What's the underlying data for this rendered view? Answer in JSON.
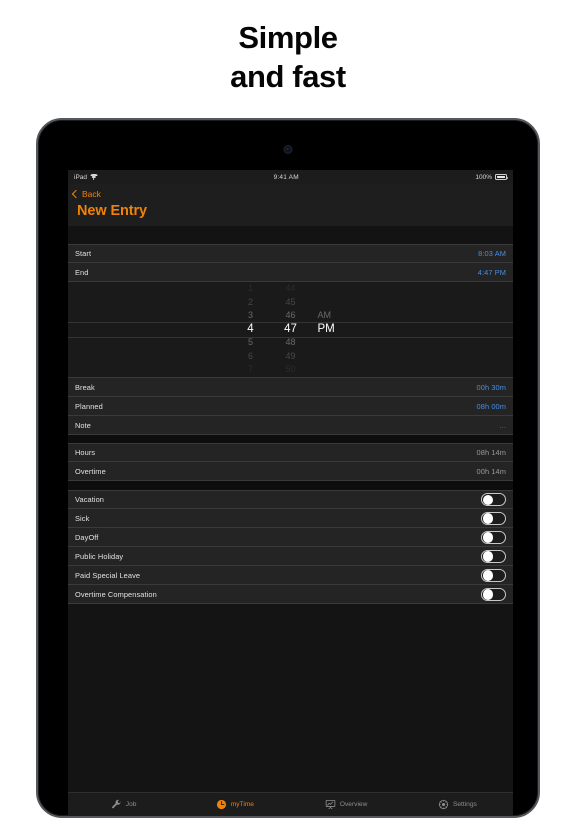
{
  "headline": {
    "line1": "Simple",
    "line2": "and fast"
  },
  "device": {
    "type": "tablet-frame",
    "camera": "front-camera-dot"
  },
  "status_bar": {
    "carrier": "iPad",
    "wifi_icon": "wifi-icon",
    "time": "9:41 AM",
    "battery_percent": "100%",
    "battery_icon": "battery-full-icon"
  },
  "nav": {
    "back_label": "Back",
    "back_icon": "chevron-left-icon",
    "title": "New Entry",
    "accent_color": "#f0820b"
  },
  "sections": {
    "time_rows": [
      {
        "label": "Start",
        "value": "8:03 AM",
        "value_style": "blue"
      },
      {
        "label": "End",
        "value": "4:47 PM",
        "value_style": "blue"
      }
    ],
    "detail_rows": [
      {
        "label": "Break",
        "value": "00h 30m",
        "value_style": "blue"
      },
      {
        "label": "Planned",
        "value": "08h 00m",
        "value_style": "blue"
      },
      {
        "label": "Note",
        "value": "...",
        "value_style": "dim"
      }
    ],
    "summary_rows": [
      {
        "label": "Hours",
        "value": "08h 14m",
        "value_style": "gray"
      },
      {
        "label": "Overtime",
        "value": "00h 14m",
        "value_style": "gray"
      }
    ],
    "toggle_rows": [
      {
        "label": "Vacation",
        "on": false
      },
      {
        "label": "Sick",
        "on": false
      },
      {
        "label": "DayOff",
        "on": false
      },
      {
        "label": "Public Holiday",
        "on": false
      },
      {
        "label": "Paid Special Leave",
        "on": false
      },
      {
        "label": "Overtime Compensation",
        "on": false
      }
    ]
  },
  "picker": {
    "hours": [
      "1",
      "2",
      "3",
      "4",
      "5",
      "6",
      "7"
    ],
    "minutes": [
      "44",
      "45",
      "46",
      "47",
      "48",
      "49",
      "50"
    ],
    "meridiem": [
      "",
      "",
      "AM",
      "PM",
      "",
      "",
      ""
    ],
    "selected": {
      "hour": "4",
      "minute": "47",
      "meridiem": "PM"
    }
  },
  "tabbar": {
    "tabs": [
      {
        "label": "Job",
        "icon": "wrench-icon",
        "active": false
      },
      {
        "label": "myTime",
        "icon": "clock-icon",
        "active": true
      },
      {
        "label": "Overview",
        "icon": "chart-board-icon",
        "active": false
      },
      {
        "label": "Settings",
        "icon": "gear-icon",
        "active": false
      }
    ]
  },
  "colors": {
    "accent": "#f0820b",
    "value_blue": "#4b8ee0",
    "row_bg": "#242424",
    "screen_bg": "#141414"
  }
}
